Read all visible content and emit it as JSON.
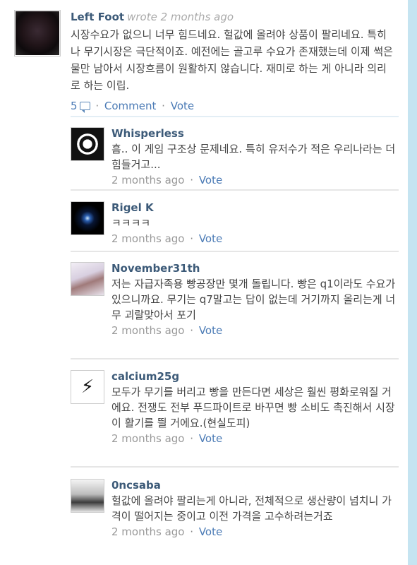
{
  "main": {
    "author": "Left Foot",
    "wrote": "wrote 2 months ago",
    "text": "시장수요가 없으니 너무 힘드네요. 헐값에 올려야 상품이 팔리네요. 특히나 무기시장은 극단적이죠. 예전에는 골고루 수요가 존재했는데 이제 썩은물만 남아서 시장흐름이 원활하지 않습니다. 재미로 하는 게 아니라 의리로 하는 이립.",
    "reply_count": "5",
    "comment_label": "Comment",
    "vote_label": "Vote"
  },
  "replies": [
    {
      "author": "Whisperless",
      "text": "흠.. 이 게임 구조상 문제네요. 특히 유저수가 적은 우리나라는 더 힘들거고...",
      "time": "2 months ago",
      "vote": "Vote",
      "avatar_bg": "#1a1a1a"
    },
    {
      "author": "Rigel K",
      "text": "ㅋㅋㅋㅋ",
      "time": "2 months ago",
      "vote": "Vote",
      "avatar_bg": "#000000"
    },
    {
      "author": "November31th",
      "text": "저는 자급자족용 빵공장만 몇개 돌립니다. 빵은 q1이라도 수요가 있으니까요. 무기는 q7말고는 답이 없는데 거기까지 올리는게 너무 괴랄맞아서 포기",
      "time": "2 months ago",
      "vote": "Vote",
      "avatar_bg": "#e9e4ee"
    },
    {
      "author": "calcium25g",
      "text": "모두가 무기를 버리고 빵을 만든다면 세상은 훨씬 평화로워질 거에요. 전쟁도 전부 푸드파이트로 바꾸면 빵 소비도 촉진해서 시장이 활기를 띌 거에요.(현실도피)",
      "time": "2 months ago",
      "vote": "Vote",
      "avatar_bg": "#ffffff"
    },
    {
      "author": "0ncsaba",
      "text": "헐값에 올려야 팔리는게 아니라, 전체적으로 생산량이 넘치니 가격이 떨어지는 중이고 이전 가격을 고수하려는거죠",
      "time": "2 months ago",
      "vote": "Vote",
      "avatar_bg": "#dcdcdc"
    }
  ]
}
